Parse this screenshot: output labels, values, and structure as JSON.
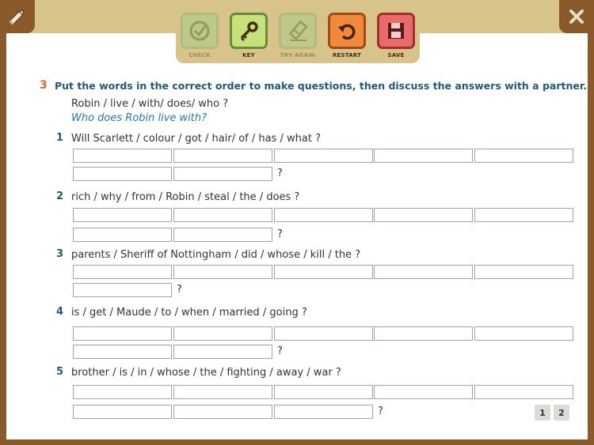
{
  "toolbar": {
    "check_label": "CHECK",
    "key_label": "KEY",
    "try_again_label": "TRY AGAIN",
    "restart_label": "RESTART",
    "save_label": "SAVE"
  },
  "exercise": {
    "number": "3",
    "instruction": "Put the words in the correct order to make questions, then discuss the answers with a partner.",
    "example_prompt": "Robin / live / with/ does/ who ?",
    "example_answer": "Who does Robin live with?",
    "questions": [
      {
        "num": "1",
        "text": "Will Scarlett / colour / got / hair/ of / has / what ?",
        "qmark": "?"
      },
      {
        "num": "2",
        "text": "rich / why / from / Robin / steal / the / does ?",
        "qmark": "?"
      },
      {
        "num": "3",
        "text": "parents / Sheriff of Nottingham / did / whose / kill / the ?",
        "qmark": "?"
      },
      {
        "num": "4",
        "text": "is / get / Maude / to / when / married / going ?",
        "qmark": "?"
      },
      {
        "num": "5",
        "text": "brother / is / in /  whose / the / fighting / away / war ?",
        "qmark": "?"
      }
    ]
  },
  "pages": [
    "1",
    "2"
  ],
  "colors": {
    "frame": "#8a5a2b",
    "band": "#d8c48a",
    "accent_orange": "#e0632c",
    "heading_blue": "#1f5a7a",
    "answer_blue": "#1f7ab0"
  },
  "icons": {
    "top_left": "pencil-icon",
    "top_right": "close-icon",
    "check": "checkmark-icon",
    "key": "key-icon",
    "try_again": "eraser-icon",
    "restart": "restart-icon",
    "save": "floppy-disk-icon"
  }
}
